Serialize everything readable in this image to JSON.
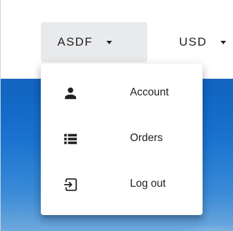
{
  "header": {
    "account_menu_label": "ASDF",
    "currency_label": "USD"
  },
  "account_menu": {
    "items": [
      {
        "label": "Account",
        "icon": "person-icon"
      },
      {
        "label": "Orders",
        "icon": "list-icon"
      },
      {
        "label": "Log out",
        "icon": "logout-icon"
      }
    ]
  },
  "colors": {
    "active_button_bg": "#e9eaec",
    "icon": "#212121",
    "hero_blue": "#1a73cf"
  }
}
